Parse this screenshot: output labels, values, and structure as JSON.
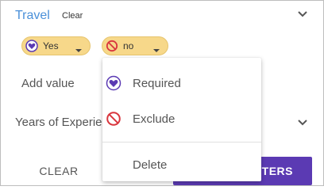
{
  "filter": {
    "title": "Travel",
    "clear_label": "Clear",
    "chips": [
      {
        "label": "Yes",
        "icon": "heart-icon",
        "icon_color": "#5b3ab3"
      },
      {
        "label": "no",
        "icon": "block-icon",
        "icon_color": "#d9363e"
      }
    ],
    "add_value_label": "Add value",
    "years_label": "Years of Experience"
  },
  "footer": {
    "clear_button": "CLEAR",
    "primary_button": "TERS"
  },
  "menu": {
    "items": [
      {
        "label": "Required",
        "icon": "heart-icon"
      },
      {
        "label": "Exclude",
        "icon": "block-icon"
      },
      {
        "label": "Delete"
      }
    ]
  },
  "colors": {
    "accent": "#5b3ab3",
    "title_blue": "#4a90d9",
    "chip_bg": "#f7d88a",
    "exclude_red": "#d9363e"
  }
}
